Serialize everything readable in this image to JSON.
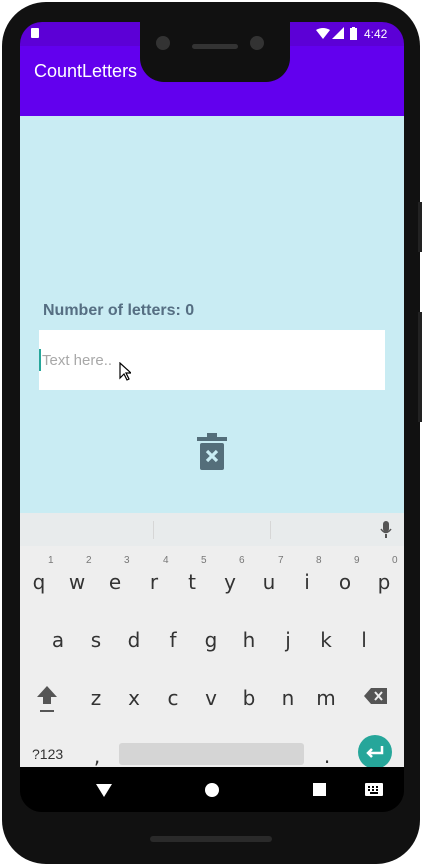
{
  "status_bar": {
    "time": "4:42"
  },
  "app": {
    "title": "CountLetters"
  },
  "main": {
    "count_label": "Number of letters: 0",
    "text_input": {
      "placeholder": "Text here..",
      "value": ""
    }
  },
  "keyboard": {
    "row1": [
      {
        "key": "q",
        "num": "1"
      },
      {
        "key": "w",
        "num": "2"
      },
      {
        "key": "e",
        "num": "3"
      },
      {
        "key": "r",
        "num": "4"
      },
      {
        "key": "t",
        "num": "5"
      },
      {
        "key": "y",
        "num": "6"
      },
      {
        "key": "u",
        "num": "7"
      },
      {
        "key": "i",
        "num": "8"
      },
      {
        "key": "o",
        "num": "9"
      },
      {
        "key": "p",
        "num": "0"
      }
    ],
    "row2": [
      "a",
      "s",
      "d",
      "f",
      "g",
      "h",
      "j",
      "k",
      "l"
    ],
    "row3": [
      "z",
      "x",
      "c",
      "v",
      "b",
      "n",
      "m"
    ],
    "row4": {
      "symbols_label": "?123",
      "comma": ",",
      "period": "."
    }
  },
  "icons": {
    "delete": "trash-x-icon",
    "shift": "shift-icon",
    "backspace": "backspace-icon",
    "mic": "mic-icon",
    "enter": "enter-icon",
    "nav": [
      "back-icon",
      "home-icon",
      "recents-icon",
      "keyboard-switch-icon"
    ]
  },
  "colors": {
    "primary": "#6200ee",
    "status_bar": "#5c00d6",
    "background": "#c9ecf3",
    "accent": "#26a69a",
    "label": "#556e82"
  }
}
